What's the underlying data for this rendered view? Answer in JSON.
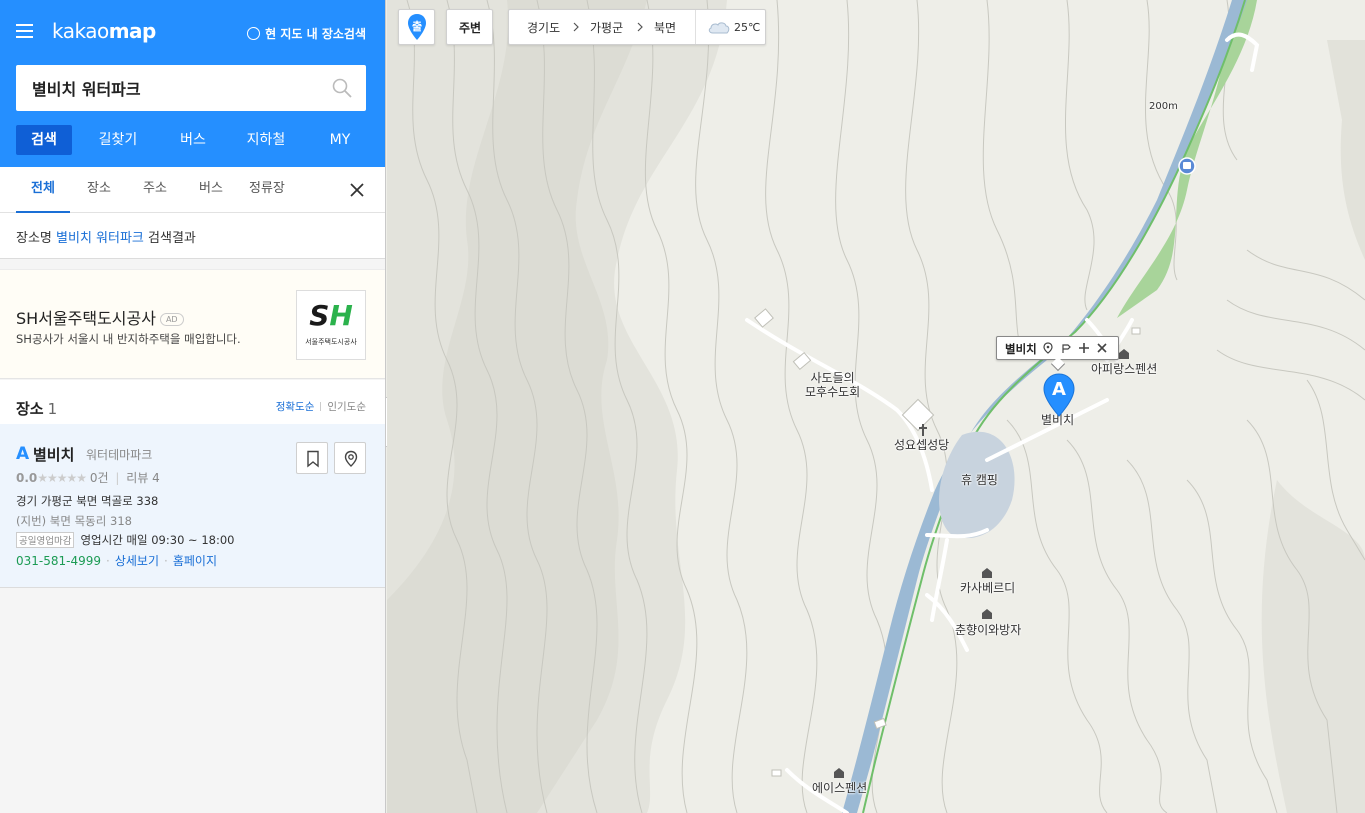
{
  "app": {
    "logo_light": "kakao",
    "logo_bold": "map",
    "here_search_label": "현 지도 내 장소검색"
  },
  "search": {
    "value": "별비치 워터파크",
    "placeholder": ""
  },
  "main_tabs": [
    "검색",
    "길찾기",
    "버스",
    "지하철",
    "MY"
  ],
  "sub_tabs": [
    "전체",
    "장소",
    "주소",
    "버스",
    "정류장"
  ],
  "result_title": {
    "prefix": "장소명",
    "keyword": "별비치 워터파크",
    "suffix": "검색결과"
  },
  "ad": {
    "name": "SH서울주택도시공사",
    "badge": "AD",
    "description": "SH공사가 서울시 내 반지하주택을 매입합니다.",
    "logo_s": "S",
    "logo_h": "H",
    "logo_caption": "서울주택도시공사"
  },
  "places": {
    "label": "장소",
    "count": "1",
    "sort_accuracy": "정확도순",
    "sort_popularity": "인기도순",
    "items": [
      {
        "marker": "A",
        "name": "별비치",
        "category": "워터테마파크",
        "score": "0.0",
        "stars": "★★★★★",
        "rating_count": "0건",
        "reviews": "리뷰 4",
        "address": "경기 가평군 북면 멱골로 338",
        "jibun": "(지번) 북면 목동리 318",
        "closed_badge": "공일영업마감",
        "hours": "영업시간 매일 09:30 ~ 18:00",
        "phone": "031-581-4999",
        "detail_link": "상세보기",
        "homepage_link": "홈페이지"
      }
    ]
  },
  "map": {
    "start_label": "출",
    "nearby_label": "주변",
    "location": [
      "경기도",
      "가평군",
      "북면"
    ],
    "weather_temp": "25℃",
    "scale_label": "200m",
    "infowindow_name": "별비치",
    "pin_letter": "A",
    "labels": {
      "church_name": "사도들의\n모후수도회",
      "chapel": "성요셉성당",
      "pension1": "아피랑스펜션",
      "pin_place": "별비치",
      "camping": "휴 캠핑",
      "casa": "카사베르디",
      "chunhyang": "춘향이와방자",
      "ace": "에이스펜션"
    }
  },
  "colors": {
    "brand_blue": "#258fff",
    "active_tab": "#0f5fd6",
    "link_blue": "#1a6fd6",
    "phone_green": "#1c9b54",
    "river": "#9bb9d4",
    "park_green": "#a8d49a"
  }
}
